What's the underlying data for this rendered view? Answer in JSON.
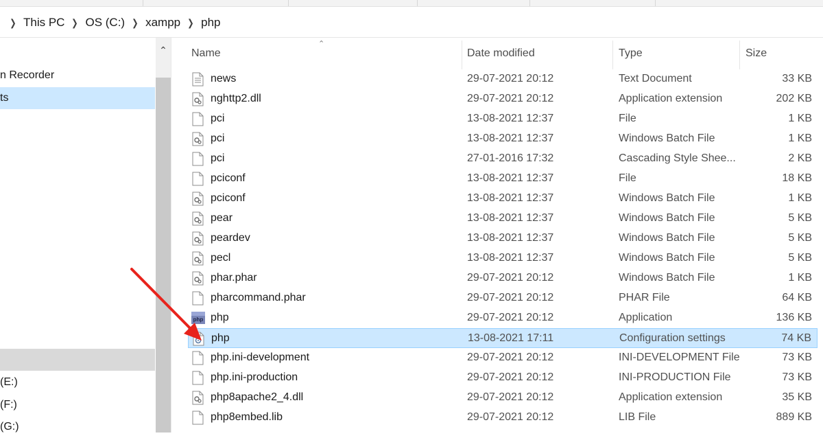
{
  "breadcrumb": {
    "items": [
      "This PC",
      "OS (C:)",
      "xampp",
      "php"
    ]
  },
  "nav": {
    "items": [
      {
        "label": "n Recorder",
        "state": "normal"
      },
      {
        "label": "ts",
        "state": "selected"
      },
      {
        "label": "",
        "state": "hover"
      },
      {
        "label": "(E:)",
        "state": "normal"
      },
      {
        "label": "(F:)",
        "state": "normal"
      },
      {
        "label": "(G:)",
        "state": "normal"
      }
    ]
  },
  "columns": {
    "name": "Name",
    "date": "Date modified",
    "type": "Type",
    "size": "Size"
  },
  "files": [
    {
      "name": "news",
      "date": "29-07-2021 20:12",
      "type": "Text Document",
      "size": "33 KB",
      "icon": "text-file-icon"
    },
    {
      "name": "nghttp2.dll",
      "date": "29-07-2021 20:12",
      "type": "Application extension",
      "size": "202 KB",
      "icon": "dll-file-icon"
    },
    {
      "name": "pci",
      "date": "13-08-2021 12:37",
      "type": "File",
      "size": "1 KB",
      "icon": "blank-file-icon"
    },
    {
      "name": "pci",
      "date": "13-08-2021 12:37",
      "type": "Windows Batch File",
      "size": "1 KB",
      "icon": "batch-file-icon"
    },
    {
      "name": "pci",
      "date": "27-01-2016 17:32",
      "type": "Cascading Style Shee...",
      "size": "2 KB",
      "icon": "blank-file-icon"
    },
    {
      "name": "pciconf",
      "date": "13-08-2021 12:37",
      "type": "File",
      "size": "18 KB",
      "icon": "blank-file-icon"
    },
    {
      "name": "pciconf",
      "date": "13-08-2021 12:37",
      "type": "Windows Batch File",
      "size": "1 KB",
      "icon": "batch-file-icon"
    },
    {
      "name": "pear",
      "date": "13-08-2021 12:37",
      "type": "Windows Batch File",
      "size": "5 KB",
      "icon": "batch-file-icon"
    },
    {
      "name": "peardev",
      "date": "13-08-2021 12:37",
      "type": "Windows Batch File",
      "size": "5 KB",
      "icon": "batch-file-icon"
    },
    {
      "name": "pecl",
      "date": "13-08-2021 12:37",
      "type": "Windows Batch File",
      "size": "5 KB",
      "icon": "batch-file-icon"
    },
    {
      "name": "phar.phar",
      "date": "29-07-2021 20:12",
      "type": "Windows Batch File",
      "size": "1 KB",
      "icon": "batch-file-icon"
    },
    {
      "name": "pharcommand.phar",
      "date": "29-07-2021 20:12",
      "type": "PHAR File",
      "size": "64 KB",
      "icon": "blank-file-icon"
    },
    {
      "name": "php",
      "date": "29-07-2021 20:12",
      "type": "Application",
      "size": "136 KB",
      "icon": "php-app-icon"
    },
    {
      "name": "php",
      "date": "13-08-2021 17:11",
      "type": "Configuration settings",
      "size": "74 KB",
      "icon": "config-file-icon",
      "selected": true
    },
    {
      "name": "php.ini-development",
      "date": "29-07-2021 20:12",
      "type": "INI-DEVELOPMENT File",
      "size": "73 KB",
      "icon": "blank-file-icon"
    },
    {
      "name": "php.ini-production",
      "date": "29-07-2021 20:12",
      "type": "INI-PRODUCTION File",
      "size": "73 KB",
      "icon": "blank-file-icon"
    },
    {
      "name": "php8apache2_4.dll",
      "date": "29-07-2021 20:12",
      "type": "Application extension",
      "size": "35 KB",
      "icon": "dll-file-icon"
    },
    {
      "name": "php8embed.lib",
      "date": "29-07-2021 20:12",
      "type": "LIB File",
      "size": "889 KB",
      "icon": "blank-file-icon"
    }
  ],
  "colors": {
    "selection": "#cce8ff",
    "selection_border": "#99d1ff",
    "annotation_arrow": "#e8231c"
  }
}
